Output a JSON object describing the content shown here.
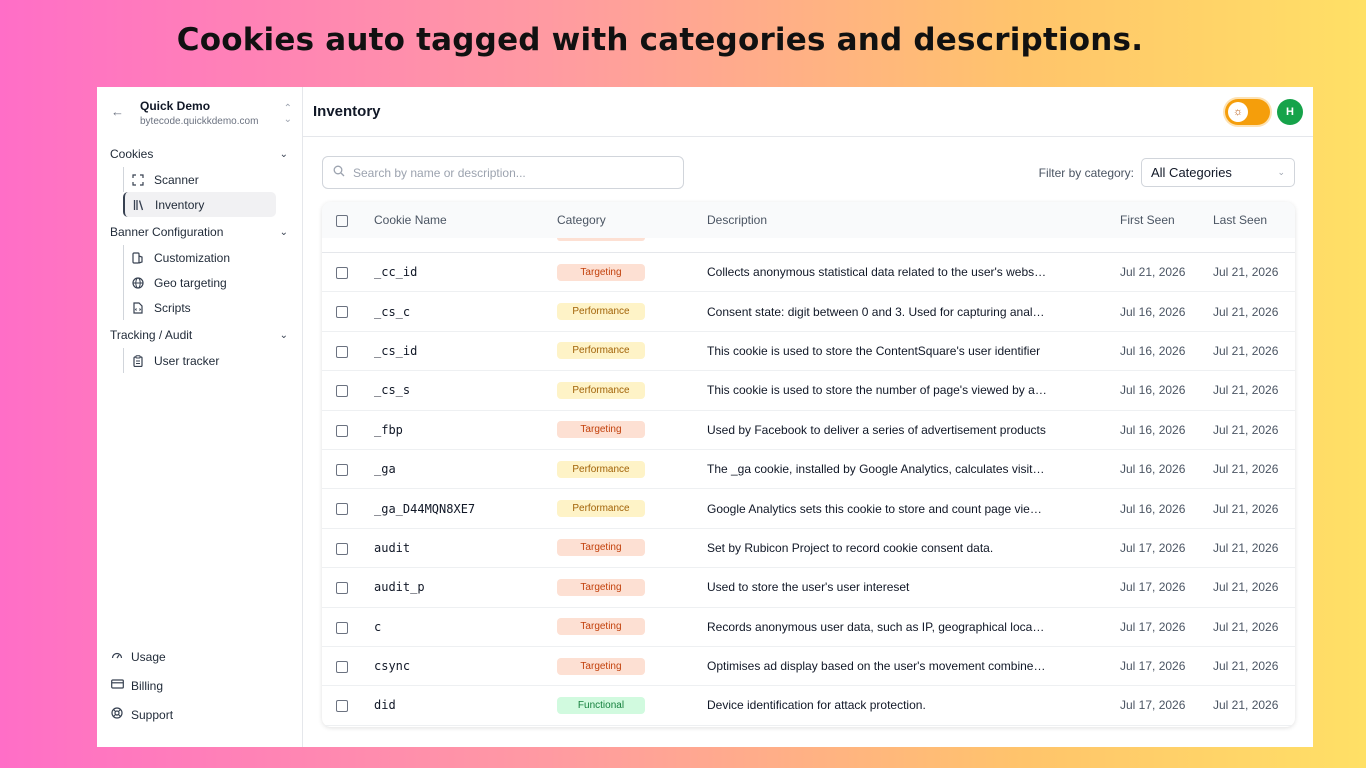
{
  "headline": "Cookies auto tagged with categories and descriptions.",
  "workspace": {
    "title": "Quick Demo",
    "domain": "bytecode.quickkdemo.com"
  },
  "sidebar": {
    "cookies_label": "Cookies",
    "scanner_label": "Scanner",
    "inventory_label": "Inventory",
    "banner_label": "Banner Configuration",
    "customization_label": "Customization",
    "geo_label": "Geo targeting",
    "scripts_label": "Scripts",
    "tracking_label": "Tracking / Audit",
    "user_tracker_label": "User tracker",
    "usage_label": "Usage",
    "billing_label": "Billing",
    "support_label": "Support"
  },
  "header": {
    "title": "Inventory",
    "avatar_initial": "H"
  },
  "search": {
    "placeholder": "Search by name or description..."
  },
  "filter": {
    "label": "Filter by category:",
    "selected": "All Categories"
  },
  "table": {
    "columns": {
      "name": "Cookie Name",
      "category": "Category",
      "description": "Description",
      "first_seen": "First Seen",
      "last_seen": "Last Seen"
    },
    "rows": [
      {
        "name": "_cc_id",
        "category": "Targeting",
        "description": "Collects anonymous statistical data related to the user's website visits",
        "first_seen": "Jul 21, 2026",
        "last_seen": "Jul 21, 2026"
      },
      {
        "name": "_cs_c",
        "category": "Performance",
        "description": "Consent state: digit between 0 and 3. Used for capturing analytics consent",
        "first_seen": "Jul 16, 2026",
        "last_seen": "Jul 21, 2026"
      },
      {
        "name": "_cs_id",
        "category": "Performance",
        "description": "This cookie is used to store the ContentSquare's user identifier",
        "first_seen": "Jul 16, 2026",
        "last_seen": "Jul 21, 2026"
      },
      {
        "name": "_cs_s",
        "category": "Performance",
        "description": "This cookie is used to store the number of page's viewed by a visitor",
        "first_seen": "Jul 16, 2026",
        "last_seen": "Jul 21, 2026"
      },
      {
        "name": "_fbp",
        "category": "Targeting",
        "description": "Used by Facebook to deliver a series of advertisement products",
        "first_seen": "Jul 16, 2026",
        "last_seen": "Jul 21, 2026"
      },
      {
        "name": "_ga",
        "category": "Performance",
        "description": "The _ga cookie, installed by Google Analytics, calculates visitor data",
        "first_seen": "Jul 16, 2026",
        "last_seen": "Jul 21, 2026"
      },
      {
        "name": "_ga_D44MQN8XE7",
        "category": "Performance",
        "description": "Google Analytics sets this cookie to store and count page views.",
        "first_seen": "Jul 16, 2026",
        "last_seen": "Jul 21, 2026"
      },
      {
        "name": "audit",
        "category": "Targeting",
        "description": "Set by Rubicon Project to record cookie consent data.",
        "first_seen": "Jul 17, 2026",
        "last_seen": "Jul 21, 2026"
      },
      {
        "name": "audit_p",
        "category": "Targeting",
        "description": "Used to store the user's user intereset",
        "first_seen": "Jul 17, 2026",
        "last_seen": "Jul 21, 2026"
      },
      {
        "name": "c",
        "category": "Targeting",
        "description": "Records anonymous user data, such as IP, geographical location",
        "first_seen": "Jul 17, 2026",
        "last_seen": "Jul 21, 2026"
      },
      {
        "name": "csync",
        "category": "Targeting",
        "description": "Optimises ad display based on the user's movement combined with data",
        "first_seen": "Jul 17, 2026",
        "last_seen": "Jul 21, 2026"
      },
      {
        "name": "did",
        "category": "Functional",
        "description": "Device identification for attack protection.",
        "first_seen": "Jul 17, 2026",
        "last_seen": "Jul 21, 2026"
      }
    ]
  },
  "colors": {
    "toggle": "#f59e0b",
    "avatar": "#16a34a",
    "targeting": "#c2410c",
    "performance": "#a16207",
    "functional": "#15803d"
  }
}
